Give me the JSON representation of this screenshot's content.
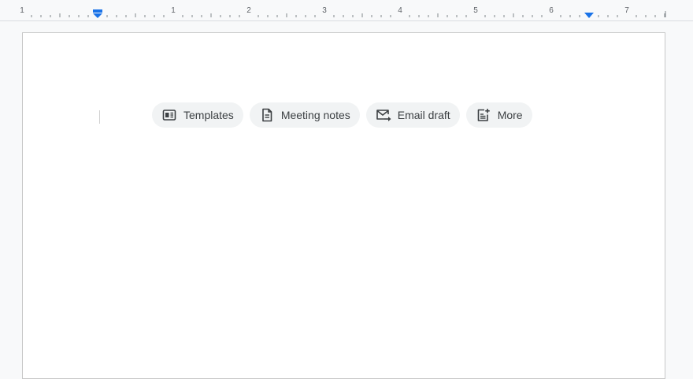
{
  "ruler": {
    "numbers": [
      "1",
      "1",
      "2",
      "3",
      "4",
      "5",
      "6",
      "7"
    ],
    "accent_color": "#1a73e8"
  },
  "chips": [
    {
      "label": "Templates",
      "icon": "templates-icon"
    },
    {
      "label": "Meeting notes",
      "icon": "document-icon"
    },
    {
      "label": "Email draft",
      "icon": "email-draft-icon"
    },
    {
      "label": "More",
      "icon": "more-document-icon"
    }
  ]
}
